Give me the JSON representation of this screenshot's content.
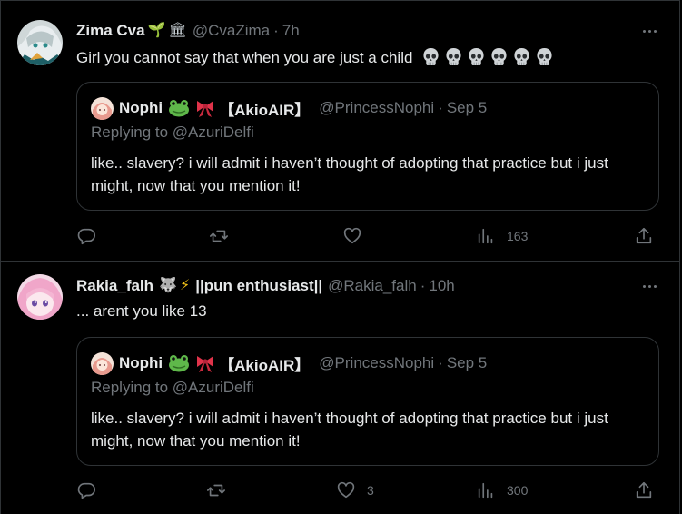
{
  "tweets": [
    {
      "name": "Zima Cva",
      "name_emojis": [
        "🌱",
        "🏛"
      ],
      "handle": "@CvaZima",
      "separator": "·",
      "time": "7h",
      "text": "Girl you cannot say that when you are just a child",
      "trailing_emoji_count": 6,
      "quote": {
        "name": "Nophi",
        "name_suffix": "【AkioAIR】",
        "handle": "@PrincessNophi",
        "separator": "·",
        "date": "Sep 5",
        "replying_to": "Replying to @AzuriDelfi",
        "text": "like.. slavery? i will admit i haven’t thought of adopting that practice but i just might, now that you mention it!"
      },
      "actions": {
        "replies": "",
        "reposts": "",
        "likes": "",
        "views": "163"
      }
    },
    {
      "name": "Rakia_falh",
      "name_emojis": [
        "🐺",
        "⚡"
      ],
      "name_suffix": "||pun enthusiast||",
      "handle": "@Rakia_falh",
      "separator": "·",
      "time": "10h",
      "text": "... arent you like 13",
      "quote": {
        "name": "Nophi",
        "name_suffix": "【AkioAIR】",
        "handle": "@PrincessNophi",
        "separator": "·",
        "date": "Sep 5",
        "replying_to": "Replying to @AzuriDelfi",
        "text": "like.. slavery? i will admit i haven’t thought of adopting that practice but i just might, now that you mention it!"
      },
      "actions": {
        "replies": "",
        "reposts": "",
        "likes": "3",
        "views": "300"
      }
    }
  ],
  "colors": {
    "background": "#000000",
    "text": "#e7e9ea",
    "muted": "#71767b",
    "border": "#2f3336"
  },
  "icons": [
    "reply-icon",
    "repost-icon",
    "like-icon",
    "views-icon",
    "share-icon",
    "more-icon",
    "skull-icon"
  ]
}
